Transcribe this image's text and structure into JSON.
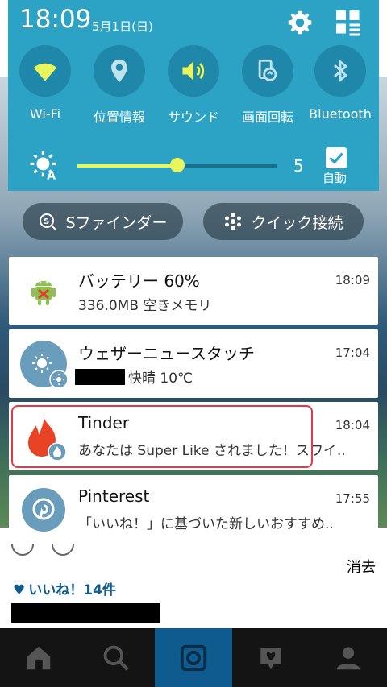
{
  "status": {
    "time": "18:09",
    "date": "5月1日(日)"
  },
  "quick_settings": [
    {
      "label": "Wi-Fi",
      "icon": "wifi-icon",
      "active": true
    },
    {
      "label": "位置情報",
      "icon": "location-icon",
      "active": false
    },
    {
      "label": "サウンド",
      "icon": "sound-icon",
      "active": true
    },
    {
      "label": "画面回転",
      "icon": "rotate-icon",
      "active": false
    },
    {
      "label": "Bluetooth",
      "icon": "bluetooth-icon",
      "active": false
    }
  ],
  "brightness": {
    "value": "5",
    "level": 0.5,
    "auto_label": "自動",
    "auto": true
  },
  "pills": {
    "sfinder": "Sファインダー",
    "quick_connect": "クイック接続"
  },
  "notifications": [
    {
      "title": "バッテリー 60%",
      "time": "18:09",
      "body": "336.0MB 空きメモリ"
    },
    {
      "title": "ウェザーニュースタッチ",
      "time": "17:04",
      "body": "快晴 10℃"
    },
    {
      "title": "Tinder",
      "time": "18:04",
      "body": "あなたは Super Like されました！スワイ.."
    },
    {
      "title": "Pinterest",
      "time": "17:55",
      "body": "「いいね！」に基づいた新しいおすすめ.."
    }
  ],
  "clear_label": "消去",
  "background": {
    "likes": "いいね！14件"
  },
  "colors": {
    "shade": "#2ca3c5",
    "slider": "#e8f55d",
    "highlight": "#e53844",
    "active_icon": "#e8f55d"
  }
}
